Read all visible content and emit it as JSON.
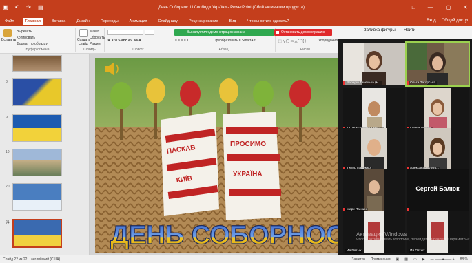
{
  "window": {
    "title": "День Соборності і Свободи України - PowerPoint (Сбой активации продукта)",
    "controls": [
      "□",
      "—",
      "▢",
      "✕"
    ]
  },
  "tabs": {
    "items": [
      "Файл",
      "Главная",
      "Вставка",
      "Дизайн",
      "Переходы",
      "Анимация",
      "Слайд-шоу",
      "Рецензирование",
      "Вид",
      "Что вы хотите сделать?"
    ],
    "active_index": 1,
    "signin": "Вход",
    "share": "Общий доступ"
  },
  "ribbon": {
    "paste": "Вставить",
    "cut": "Вырезать",
    "copy": "Копировать",
    "format_painter": "Формат по образцу",
    "clipboard_caption": "Буфер обмена",
    "new_slide": "Создать слайд",
    "layout": "Макет",
    "reset": "Сбросить",
    "section": "Раздел",
    "slides_caption": "Слайды",
    "font_caption": "Шрифт",
    "paragraph_caption": "Абзац",
    "convert_smartart": "Преобразовать в SmartArt",
    "fill": "Заливка фигуры",
    "find": "Найти",
    "arrange": "Упорядочить",
    "drawing_caption": "Рисов..."
  },
  "share_bar": {
    "text": "Вы запустили демонстрацию экрана",
    "stop_label": "Остановить демонстрацию"
  },
  "thumbnails": [
    {
      "num": "",
      "colors": [
        "#7a5a3a",
        "#b09070"
      ]
    },
    {
      "num": "8",
      "colors": [
        "#2a4fa5",
        "#e8c82a"
      ]
    },
    {
      "num": "9",
      "colors": [
        "#1d5bb0",
        "#f2d23a"
      ]
    },
    {
      "num": "10",
      "colors": [
        "#c8b088",
        "#6a7f5a"
      ]
    },
    {
      "num": "20",
      "colors": [
        "#4a7ec0",
        "#e8f0f8"
      ]
    },
    {
      "num": "21",
      "colors": [
        "#1a4a9a",
        "#f0c830"
      ]
    },
    {
      "num": "22",
      "colors": [
        "#3a6ab0",
        "#f0d040"
      ]
    }
  ],
  "slide": {
    "caption": "ДЕНЬ СОБОРНОСТІ",
    "towel_left": "ПАСКАВ КИЇВ",
    "towel_right": "ПРОСИМО УКРАЇНА"
  },
  "participants": [
    {
      "name": "Валерія Танецька (м...",
      "photo": true,
      "active": false
    },
    {
      "name": "Ольга Загорська",
      "photo": true,
      "active": true
    },
    {
      "name": "ТК 26 Єлизавета Мос...",
      "photo": true,
      "active": false
    },
    {
      "name": "Олена Липчук",
      "photo": true,
      "active": false
    },
    {
      "name": "Тимур Пацимко",
      "photo": true,
      "active": false
    },
    {
      "name": "Александра Лиго...",
      "photo": true,
      "active": false
    },
    {
      "name": "Марк Панкин",
      "photo": true,
      "active": false
    },
    {
      "name": "",
      "photo": false,
      "active": false,
      "big": "Сергей Балюк"
    },
    {
      "name": "Ия Пятых",
      "photo": true,
      "active": false
    },
    {
      "name": "Ия Пятых",
      "photo": true,
      "active": false
    }
  ],
  "watermark": {
    "heading": "Активация Windows",
    "text": "Чтобы активировать Windows, перейдите в раздел \"Параметры\"."
  },
  "status": {
    "slide_info": "Слайд 22 из 22",
    "language": "английский (США)",
    "notes": "Заметки",
    "comments": "Примечания",
    "zoom": "88 %"
  },
  "colors": {
    "accent": "#c43e1c",
    "share_green": "#2fa84f",
    "stop_red": "#e0282a"
  }
}
